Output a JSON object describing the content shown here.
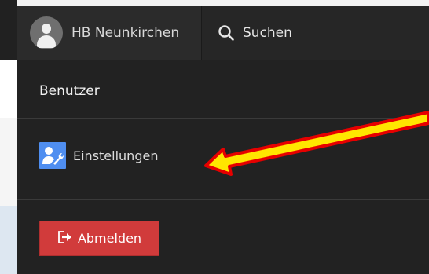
{
  "header": {
    "user_name": "HB Neunkirchen",
    "search_label": "Suchen",
    "avatar_icon": "user-avatar-icon",
    "search_icon": "search-icon"
  },
  "menu": {
    "section_title": "Benutzer",
    "settings_label": "Einstellungen",
    "settings_icon": "user-settings-icon",
    "logout_label": "Abmelden",
    "logout_icon": "sign-out-icon"
  },
  "colors": {
    "panel_bg": "#222222",
    "settings_icon_bg": "#4f8ef0",
    "logout_bg": "#d13b3b",
    "arrow_fill": "#ffe600",
    "arrow_outline": "#e60000"
  }
}
